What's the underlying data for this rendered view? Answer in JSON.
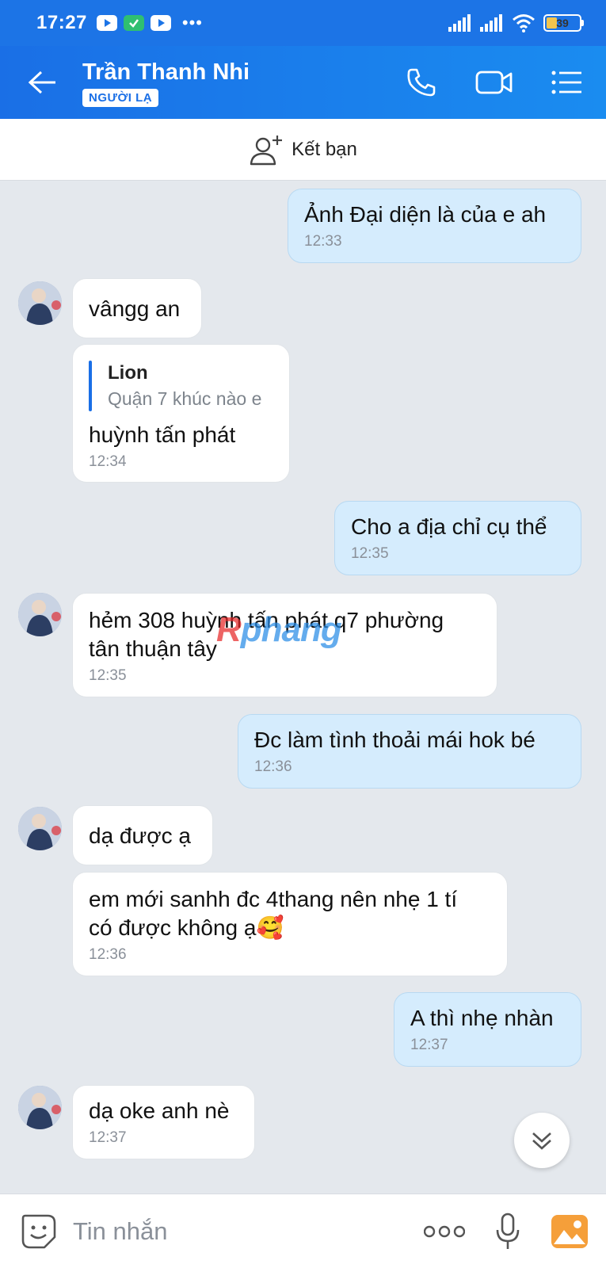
{
  "status_bar": {
    "time": "17:27",
    "more": "•••",
    "battery": "39",
    "battery_level": 0.39
  },
  "header": {
    "contact_name": "Trần Thanh Nhi",
    "badge": "NGƯỜI LẠ"
  },
  "friend_bar": {
    "label": "Kết bạn"
  },
  "messages": [
    {
      "dir": "out",
      "text": "Ảnh Đại diện là của e ah",
      "time": "12:33"
    },
    {
      "dir": "in",
      "text": "vângg an"
    },
    {
      "dir": "in",
      "quote_name": "Lion",
      "quote_text": "Quận 7 khúc nào e",
      "text": "huỳnh tấn phát",
      "time": "12:34"
    },
    {
      "dir": "out",
      "text": "Cho a địa chỉ cụ thể",
      "time": "12:35"
    },
    {
      "dir": "in",
      "text_line1": "hẻm 308 huỳnh tấn phát q7 phường",
      "text_line2": "tân thuận tây",
      "time": "12:35"
    },
    {
      "dir": "out",
      "text": "Đc làm tình thoải mái hok bé",
      "time": "12:36"
    },
    {
      "dir": "in",
      "text": "dạ được ạ"
    },
    {
      "dir": "in",
      "text_line1": "em mới sanhh đc 4thang nên nhẹ 1 tí",
      "text_line2": "có được không ạ🥰",
      "time": "12:36"
    },
    {
      "dir": "out",
      "text": "A thì nhẹ nhàn",
      "time": "12:37"
    },
    {
      "dir": "in",
      "text": "dạ oke anh nè",
      "time": "12:37"
    }
  ],
  "watermark": {
    "part1": "R",
    "part2": "phang"
  },
  "input": {
    "placeholder": "Tin nhắn"
  },
  "colors": {
    "header": "#1a6fe6",
    "bubble_out": "#d5ecfd",
    "bubble_in": "#ffffff",
    "background": "#e4e8ed"
  }
}
